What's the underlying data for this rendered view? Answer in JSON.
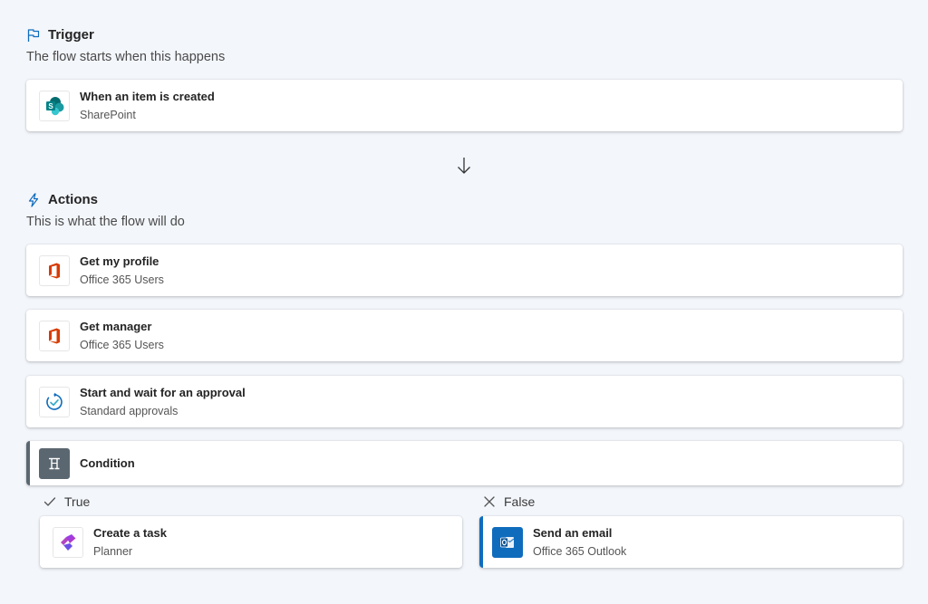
{
  "trigger": {
    "heading": "Trigger",
    "subtitle": "The flow starts when this happens",
    "icon": "flag-icon",
    "card": {
      "title": "When an item is created",
      "connector": "SharePoint",
      "icon": "sharepoint-icon"
    }
  },
  "actions": {
    "heading": "Actions",
    "subtitle": "This is what the flow will do",
    "icon": "lightning-icon",
    "cards": [
      {
        "title": "Get my profile",
        "connector": "Office 365 Users",
        "icon": "office-icon"
      },
      {
        "title": "Get manager",
        "connector": "Office 365 Users",
        "icon": "office-icon"
      },
      {
        "title": "Start and wait for an approval",
        "connector": "Standard approvals",
        "icon": "approvals-icon"
      }
    ],
    "condition": {
      "title": "Condition",
      "icon": "condition-icon"
    }
  },
  "branches": {
    "true": {
      "label": "True",
      "icon": "check-icon",
      "card": {
        "title": "Create a task",
        "connector": "Planner",
        "icon": "planner-icon"
      }
    },
    "false": {
      "label": "False",
      "icon": "close-icon",
      "card": {
        "title": "Send an email",
        "connector": "Office 365 Outlook",
        "icon": "outlook-icon"
      }
    }
  },
  "colors": {
    "background": "#f3f6fb",
    "accent_blue": "#0f6cbd",
    "condition_gray": "#5b6770"
  }
}
